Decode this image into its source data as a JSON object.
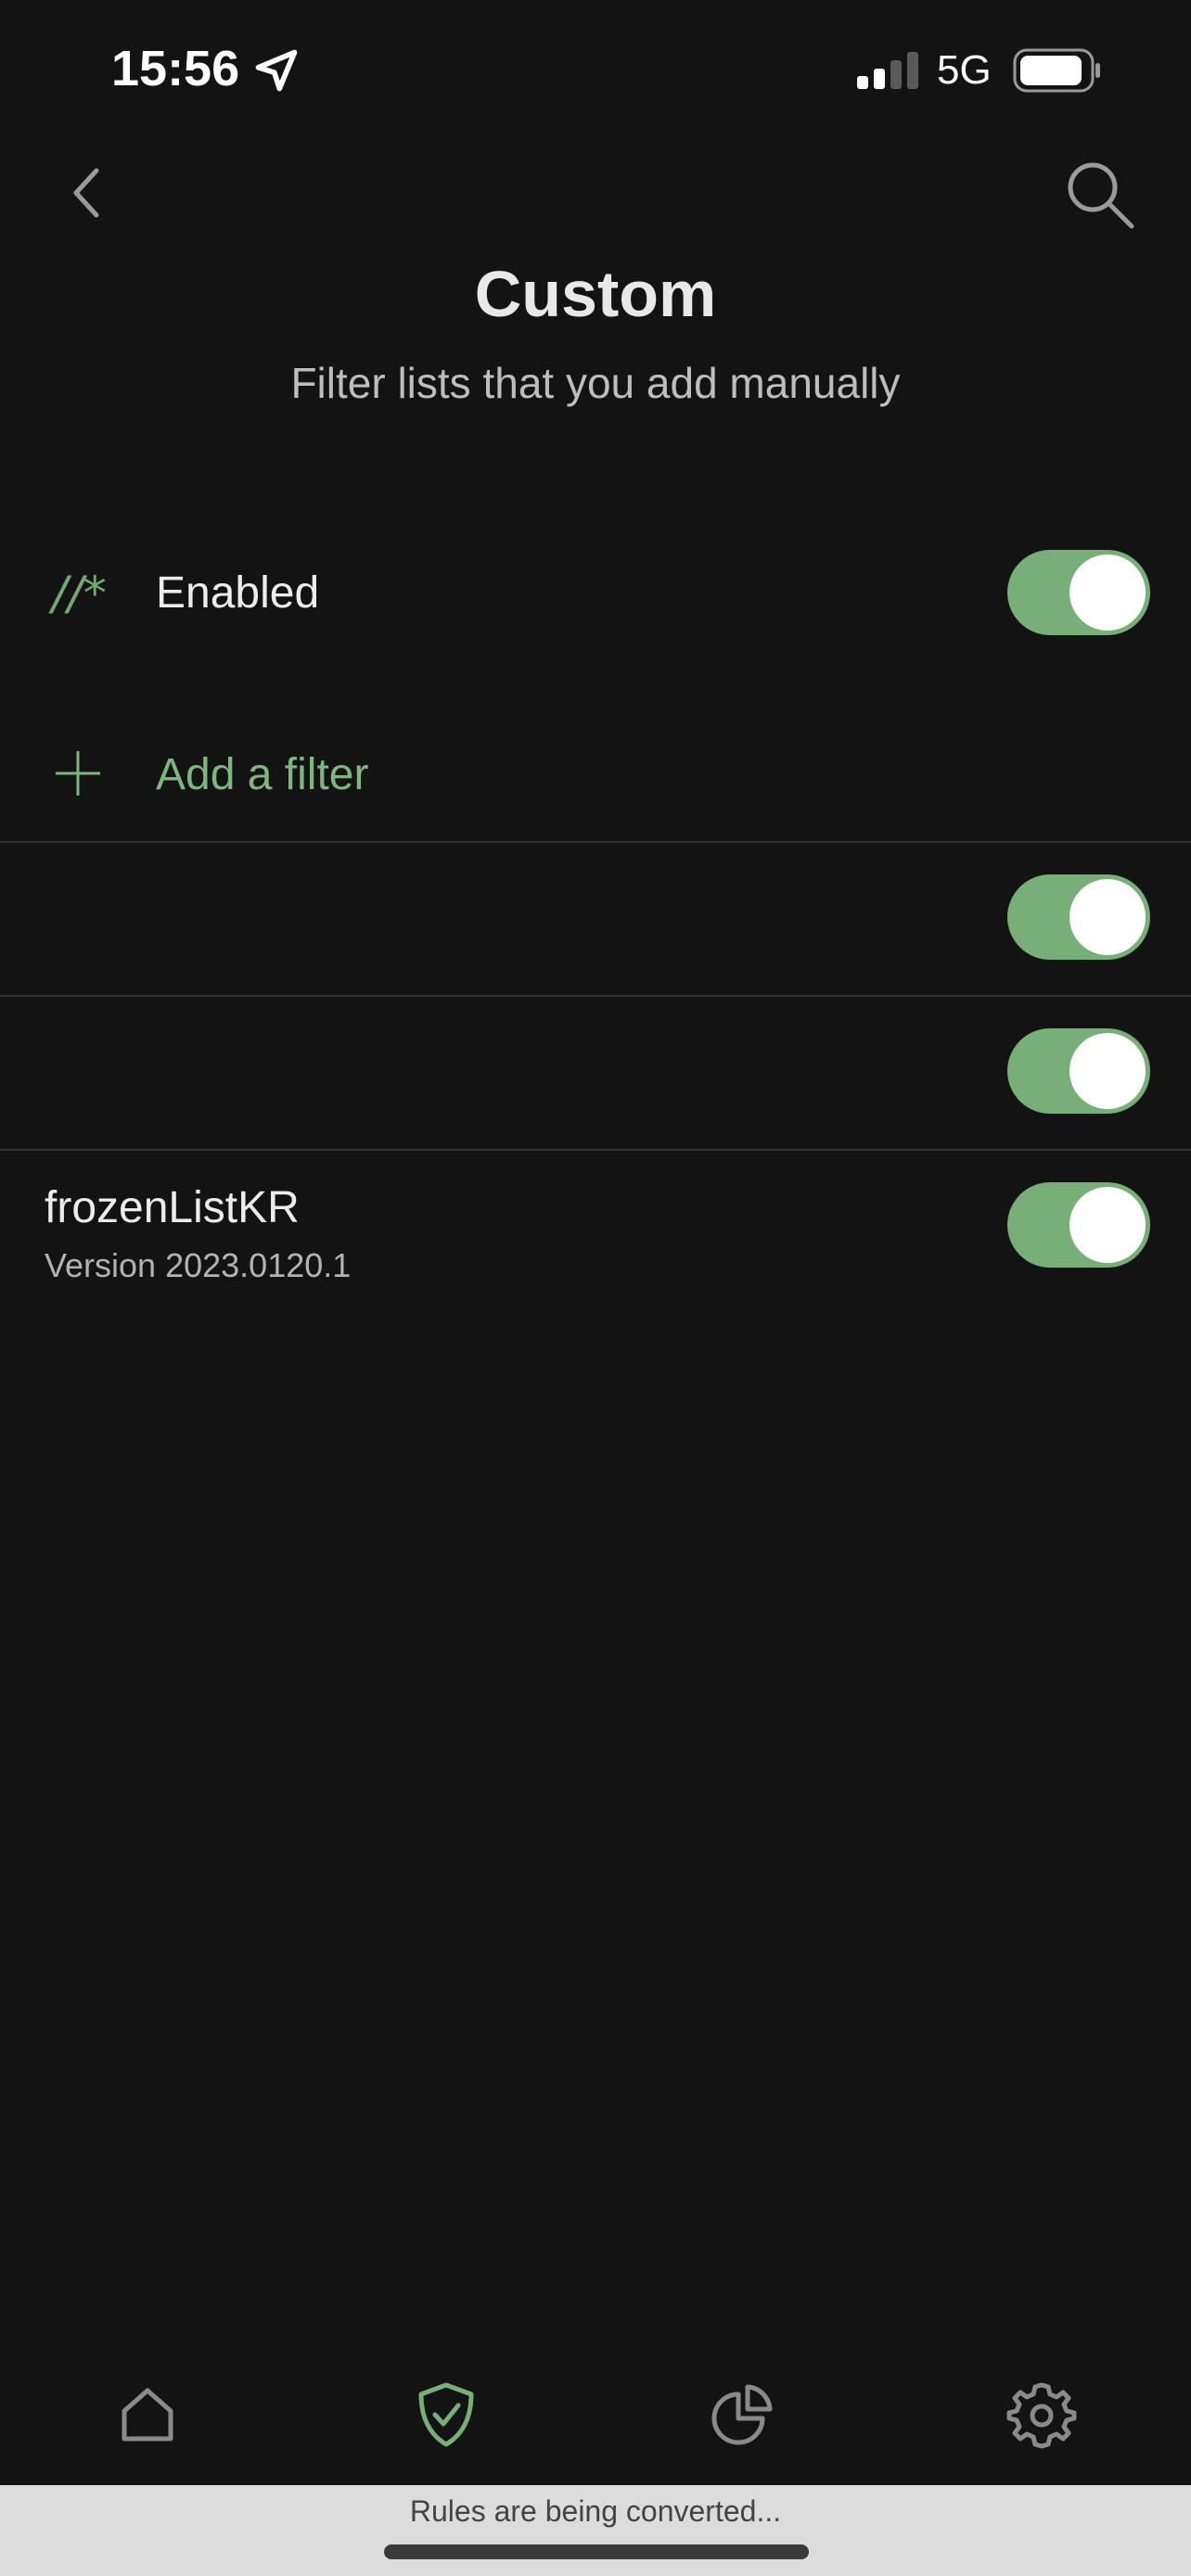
{
  "status_bar": {
    "time": "15:56",
    "network": "5G",
    "icons": [
      "location-arrow-icon",
      "signal-icon",
      "battery-icon"
    ]
  },
  "header": {
    "title": "Custom",
    "subtitle": "Filter lists that you add manually",
    "icons": [
      "chevron-left-icon",
      "search-icon"
    ]
  },
  "enabled_row": {
    "icon_glyph": "//*",
    "label": "Enabled",
    "toggle_on": true
  },
  "add_filter": {
    "label": "Add a filter",
    "icon": "plus-icon"
  },
  "filters": [
    {
      "name": "",
      "version": "",
      "enabled": true
    },
    {
      "name": "",
      "version": "",
      "enabled": true
    },
    {
      "name": "frozenListKR",
      "version": "Version 2023.0120.1",
      "enabled": true
    }
  ],
  "tab_bar": {
    "tabs": [
      {
        "icon": "home-icon",
        "active": false
      },
      {
        "icon": "shield-check-icon",
        "active": true
      },
      {
        "icon": "pie-chart-icon",
        "active": false
      },
      {
        "icon": "gear-icon",
        "active": false
      }
    ]
  },
  "banner": {
    "text": "Rules are being converted..."
  },
  "colors": {
    "background": "#131313",
    "accent": "#78ae78",
    "accent_text": "#7fb57f",
    "banner": "#dcdcdc"
  }
}
